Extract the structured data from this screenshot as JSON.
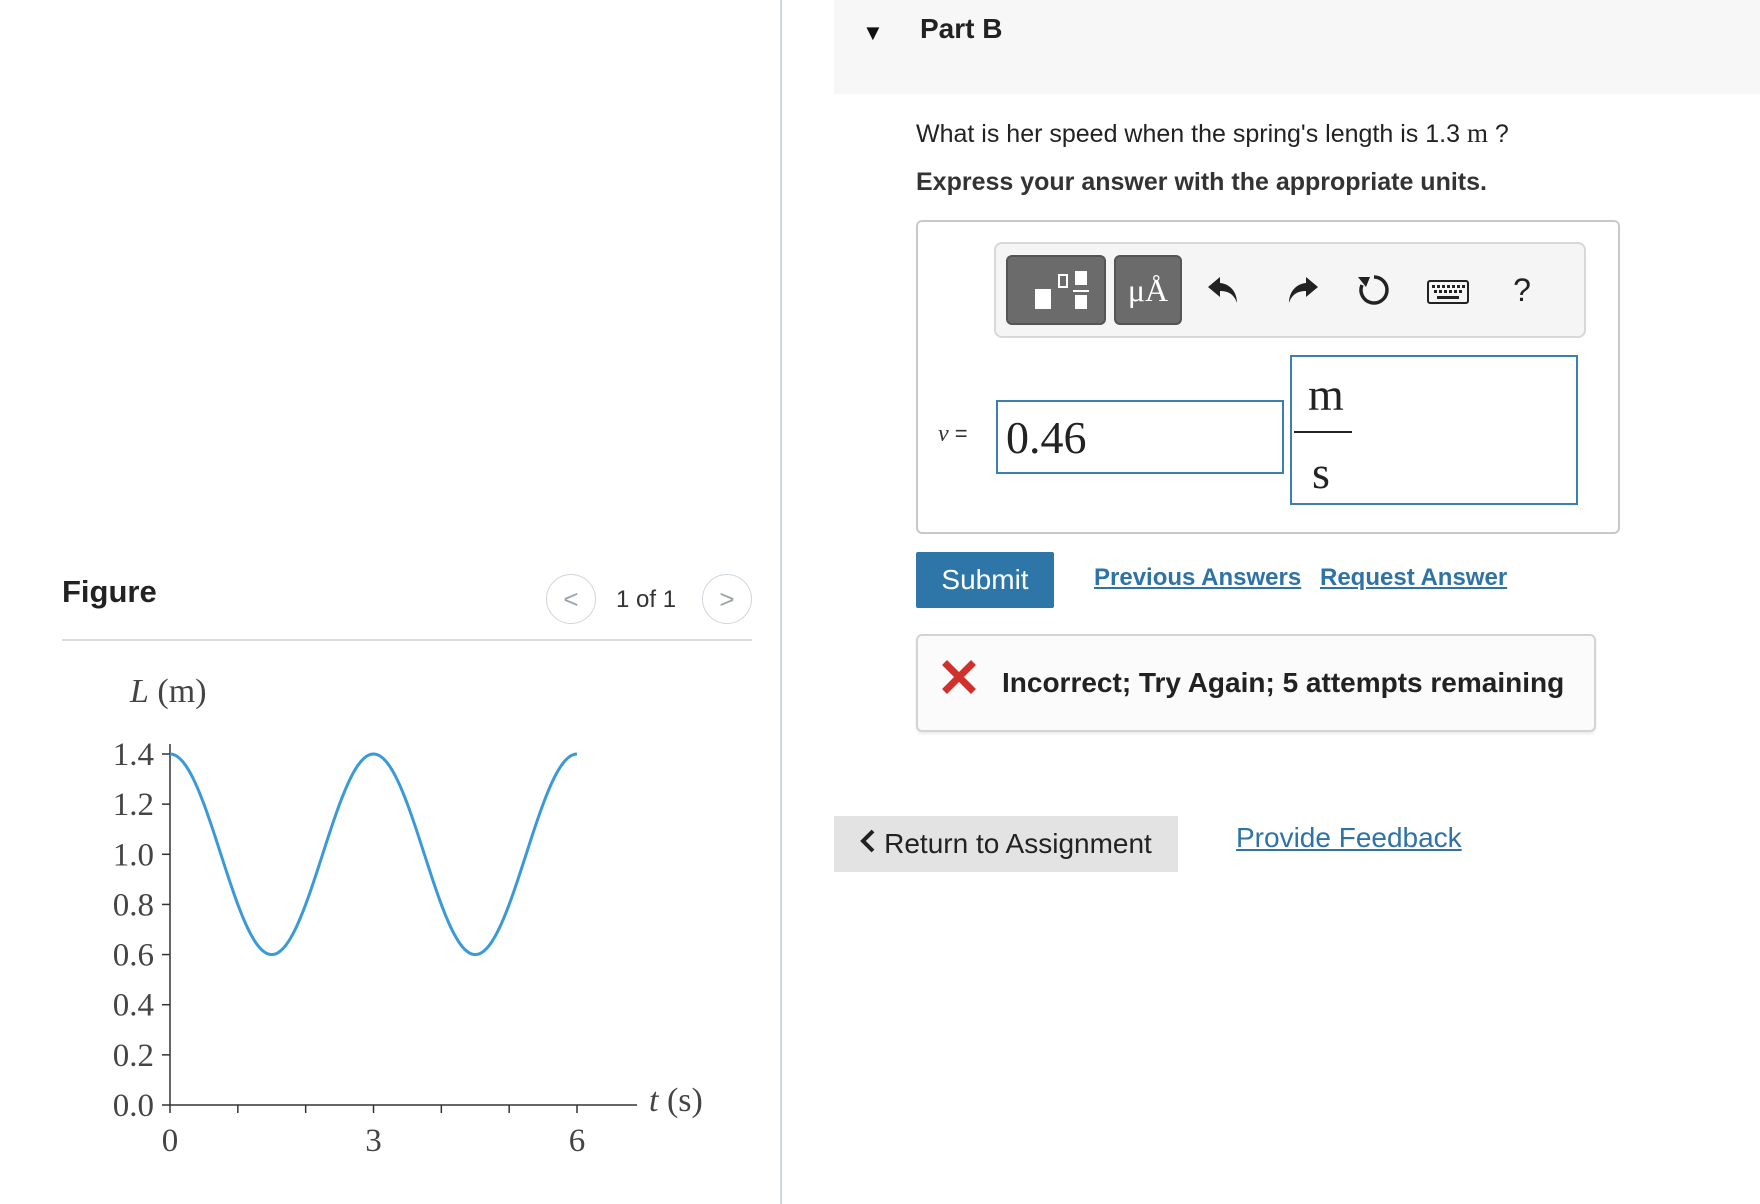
{
  "figure": {
    "title": "Figure",
    "pager": "1 of 1",
    "prev_glyph": "<",
    "next_glyph": ">"
  },
  "chart_data": {
    "type": "line",
    "ylabel_italic": "L",
    "ylabel_unit": "(m)",
    "xlabel_italic": "t",
    "xlabel_unit": "(s)",
    "y_ticks": [
      "1.4",
      "1.2",
      "1.0",
      "0.8",
      "0.6",
      "0.4",
      "0.2",
      "0.0"
    ],
    "x_ticks": [
      "0",
      "3",
      "6"
    ],
    "xlim": [
      0,
      6
    ],
    "ylim": [
      0,
      1.4
    ],
    "series": [
      {
        "color": "#3a9ad9",
        "x": [
          0,
          0.75,
          1.5,
          2.25,
          3.0,
          3.75,
          4.5,
          5.25,
          6.0
        ],
        "y": [
          1.4,
          1.0,
          0.6,
          1.0,
          1.4,
          1.0,
          0.6,
          1.0,
          1.4
        ]
      }
    ]
  },
  "part": {
    "title": "Part B",
    "question_prefix": "What is her speed when the spring's length is 1.3",
    "question_unit": "m",
    "question_suffix": "?",
    "instruction": "Express your answer with the appropriate units."
  },
  "toolbar": {
    "units_btn_label": "μÅ",
    "help_label": "?"
  },
  "answer": {
    "variable": "v",
    "equals": "=",
    "value": "0.46",
    "unit_numerator": "m",
    "unit_denominator": "s"
  },
  "actions": {
    "submit": "Submit",
    "previous_answers": "Previous Answers",
    "request_answer": "Request Answer"
  },
  "feedback": {
    "message": "Incorrect; Try Again; 5 attempts remaining",
    "status_color": "#d0312d"
  },
  "footer": {
    "return_label": "Return to Assignment",
    "provide_feedback": "Provide Feedback"
  }
}
